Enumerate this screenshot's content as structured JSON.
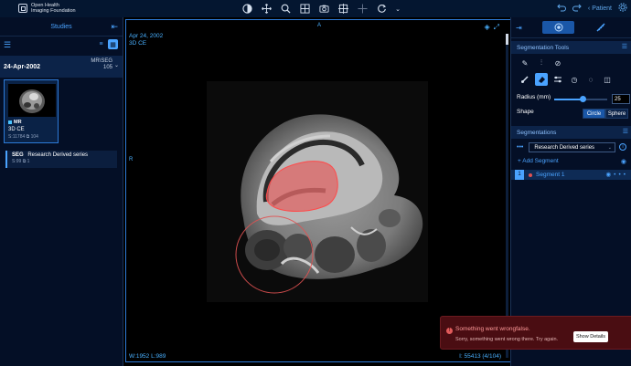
{
  "header": {
    "logo_line1": "Open Health",
    "logo_line2": "Imaging Foundation",
    "tools": [
      "contrast-icon",
      "move-icon",
      "zoom-icon",
      "layout-icon",
      "camera-icon",
      "crosshair-icon",
      "crosshair-alt-icon",
      "reset-icon",
      "chevron-down-icon"
    ],
    "undo_icon": "undo-icon",
    "redo_icon": "redo-icon",
    "patient_label": "Patient",
    "settings_icon": "gear-icon"
  },
  "left_panel": {
    "title": "Studies",
    "study": {
      "date": "24-Apr-2002",
      "modality": "MR\\SEG",
      "count": "105"
    },
    "series": {
      "modality": "MR",
      "description": "3D CE",
      "series_number": "S:11784",
      "instances": "104"
    },
    "seg_series": {
      "modality": "SEG",
      "description": "Research Derived series",
      "series_number": "S:99",
      "instances": "1"
    }
  },
  "viewport": {
    "date": "Apr 24, 2002",
    "series_desc": "3D CE",
    "orient_top": "A",
    "orient_left": "R",
    "wl_w_label": "W:",
    "wl_w": "1952",
    "wl_l_label": "L:",
    "wl_l": "989",
    "image_index": "I: 55413 (4/104)"
  },
  "toast": {
    "title": "Something went wrongfalse.",
    "body": "Sorry, something went wrong there. Try again.",
    "button": "Show Details"
  },
  "right_panel": {
    "seg_tools_title": "Segmentation Tools",
    "radius_label": "Radius (mm)",
    "radius_value": "25",
    "radius_fraction": 0.55,
    "shape_label": "Shape",
    "shape_circle": "Circle",
    "shape_sphere": "Sphere",
    "segmentations_title": "Segmentations",
    "seg_series_name": "Research Derived series",
    "add_segment": "+ Add Segment",
    "segment_index": "1",
    "segment_name": "Segment 1",
    "segment_color": "#e05252"
  },
  "colors": {
    "accent": "#4aa3ff",
    "panel_bg": "#040f26",
    "error_bg": "#4a0d12"
  }
}
